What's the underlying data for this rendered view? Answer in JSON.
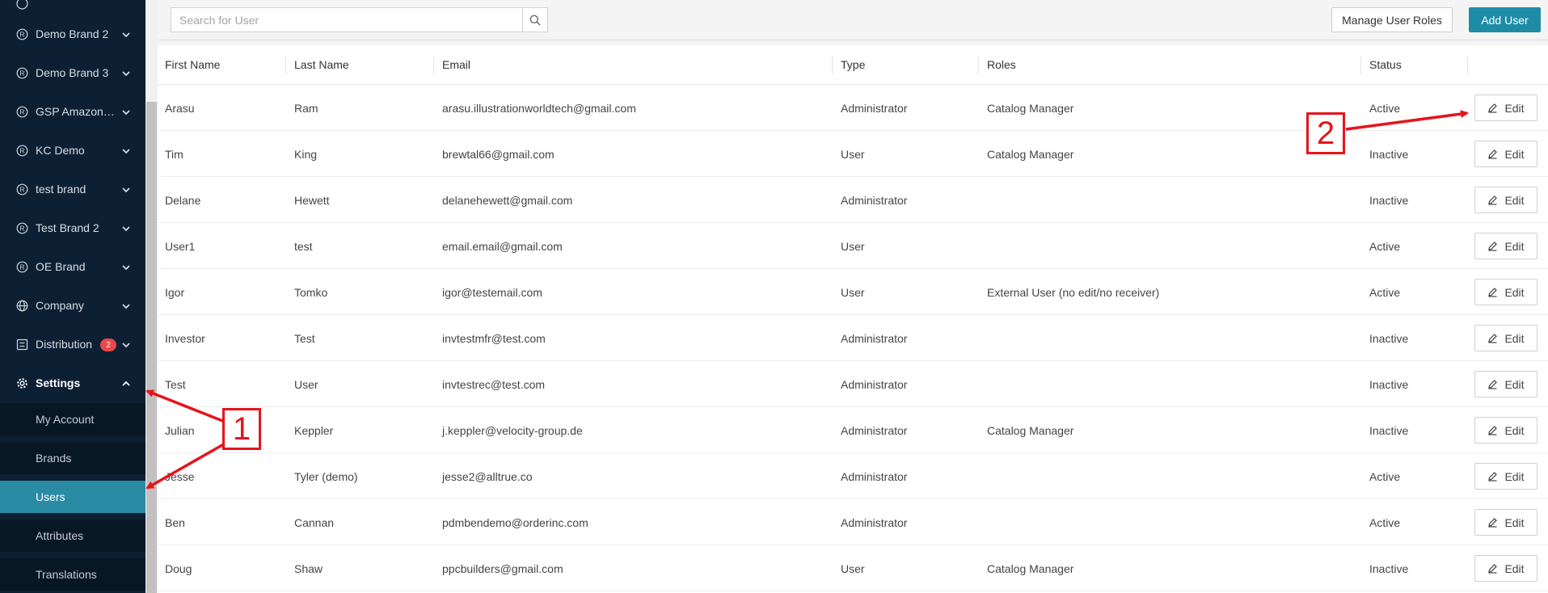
{
  "sidebar": {
    "items": [
      {
        "label": "Demo Brand 2",
        "icon": "registered-icon"
      },
      {
        "label": "Demo Brand 3",
        "icon": "registered-icon"
      },
      {
        "label": "GSP Amazon test",
        "icon": "registered-icon"
      },
      {
        "label": "KC Demo",
        "icon": "registered-icon"
      },
      {
        "label": "test brand",
        "icon": "registered-icon"
      },
      {
        "label": "Test Brand 2",
        "icon": "registered-icon"
      },
      {
        "label": "OE Brand",
        "icon": "registered-icon"
      },
      {
        "label": "Company",
        "icon": "globe-icon"
      },
      {
        "label": "Distribution",
        "icon": "distribution-icon",
        "badge": "2"
      },
      {
        "label": "Settings",
        "icon": "gear-icon"
      }
    ],
    "settings_submenu": [
      "My Account",
      "Brands",
      "Users",
      "Attributes",
      "Translations"
    ],
    "active_submenu": "Users"
  },
  "toolbar": {
    "search_placeholder": "Search for User",
    "manage_roles_label": "Manage User Roles",
    "add_user_label": "Add User"
  },
  "table": {
    "columns": [
      "First Name",
      "Last Name",
      "Email",
      "Type",
      "Roles",
      "Status"
    ],
    "edit_label": "Edit",
    "rows": [
      {
        "first": "Arasu",
        "last": "Ram",
        "email": "arasu.illustrationworldtech@gmail.com",
        "type": "Administrator",
        "roles": "Catalog Manager",
        "status": "Active"
      },
      {
        "first": "Tim",
        "last": "King",
        "email": "brewtal66@gmail.com",
        "type": "User",
        "roles": "Catalog Manager",
        "status": "Inactive"
      },
      {
        "first": "Delane",
        "last": "Hewett",
        "email": "delanehewett@gmail.com",
        "type": "Administrator",
        "roles": "",
        "status": "Inactive"
      },
      {
        "first": "User1",
        "last": "test",
        "email": "email.email@gmail.com",
        "type": "User",
        "roles": "",
        "status": "Active"
      },
      {
        "first": "Igor",
        "last": "Tomko",
        "email": "igor@testemail.com",
        "type": "User",
        "roles": "External User (no edit/no receiver)",
        "status": "Active"
      },
      {
        "first": "Investor",
        "last": "Test",
        "email": "invtestmfr@test.com",
        "type": "Administrator",
        "roles": "",
        "status": "Inactive"
      },
      {
        "first": "Test",
        "last": "User",
        "email": "invtestrec@test.com",
        "type": "Administrator",
        "roles": "",
        "status": "Inactive"
      },
      {
        "first": "Julian",
        "last": "Keppler",
        "email": "j.keppler@velocity-group.de",
        "type": "Administrator",
        "roles": "Catalog Manager",
        "status": "Inactive"
      },
      {
        "first": "Jesse",
        "last": "Tyler (demo)",
        "email": "jesse2@alltrue.co",
        "type": "Administrator",
        "roles": "",
        "status": "Active"
      },
      {
        "first": "Ben",
        "last": "Cannan",
        "email": "pdmbendemo@orderinc.com",
        "type": "Administrator",
        "roles": "",
        "status": "Active"
      },
      {
        "first": "Doug",
        "last": "Shaw",
        "email": "ppcbuilders@gmail.com",
        "type": "User",
        "roles": "Catalog Manager",
        "status": "Inactive"
      }
    ]
  },
  "annotations": {
    "callout_1": "1",
    "callout_2": "2",
    "color": "#e6141c"
  },
  "colors": {
    "sidebar_bg": "#0d2033",
    "accent": "#1f8ca6",
    "active_nav": "#2a8ba5",
    "badge": "#e94848"
  }
}
